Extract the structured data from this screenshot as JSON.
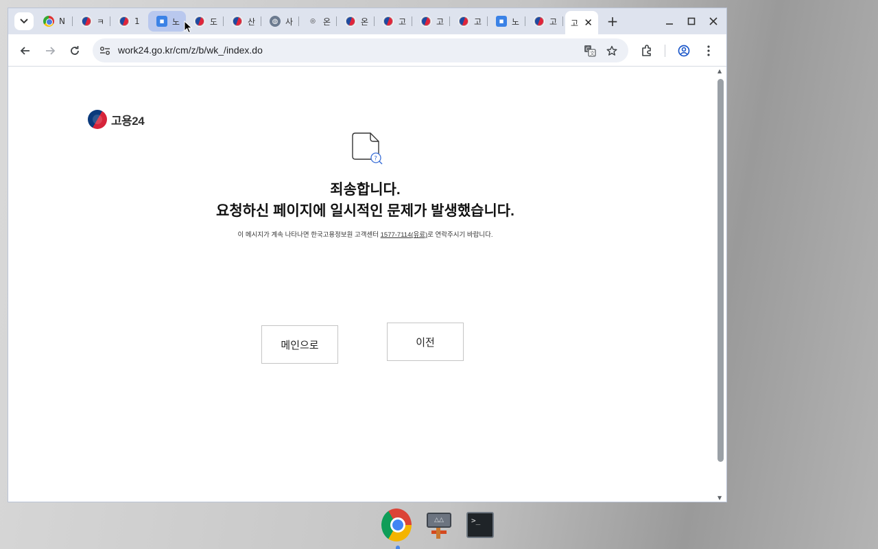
{
  "browser": {
    "tabs": [
      {
        "favicon": "chrome-icon",
        "label": "N"
      },
      {
        "favicon": "taegeuk-icon",
        "label": "ㅋ"
      },
      {
        "favicon": "taegeuk-icon",
        "label": "1"
      },
      {
        "favicon": "blue-app-icon",
        "label": "노"
      },
      {
        "favicon": "taegeuk-icon",
        "label": "도"
      },
      {
        "favicon": "taegeuk-icon",
        "label": "산"
      },
      {
        "favicon": "globe-icon",
        "label": "사"
      },
      {
        "favicon": "text-logo-icon",
        "label": "온"
      },
      {
        "favicon": "taegeuk-icon",
        "label": "온"
      },
      {
        "favicon": "taegeuk-icon",
        "label": "고"
      },
      {
        "favicon": "taegeuk-icon",
        "label": "고"
      },
      {
        "favicon": "taegeuk-icon",
        "label": "고"
      },
      {
        "favicon": "blue-app-icon",
        "label": "노"
      },
      {
        "favicon": "taegeuk-icon",
        "label": "고"
      }
    ],
    "active_tab": {
      "label": "고"
    },
    "url": "work24.go.kr/cm/z/b/wk_/index.do"
  },
  "page": {
    "logo_text": "고용24",
    "title_line1": "죄송합니다.",
    "title_line2": "요청하신 페이지에 일시적인 문제가 발생했습니다.",
    "notice_prefix": "이 메시지가 계속 나타나면 한국고용정보원 고객센터 ",
    "notice_phone": "1577-7114(유료)",
    "notice_suffix": "로 연락주시기 바랍니다.",
    "btn_main": "메인으로",
    "btn_prev": "이전"
  },
  "taskbar": {
    "apps": [
      "chrome-icon",
      "network-tool-icon",
      "terminal-icon"
    ],
    "terminal_prompt": ">_"
  }
}
